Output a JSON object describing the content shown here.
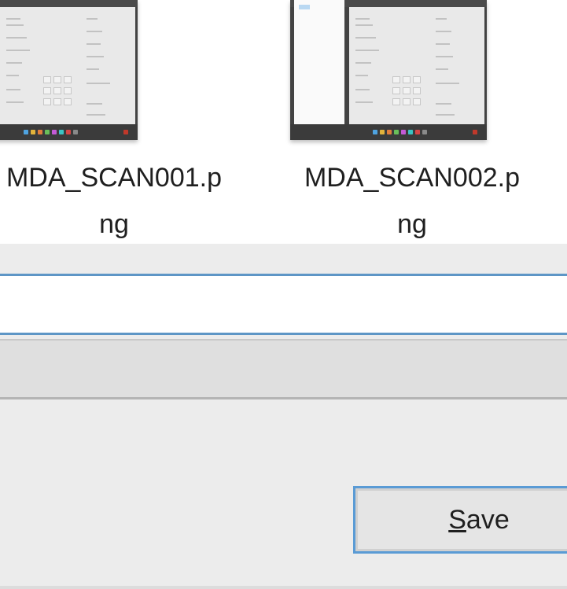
{
  "files": [
    {
      "name_line1": "MDA_SCAN001.p",
      "name_line2": "ng",
      "thumbnail_icon": "screenshot-thumbnail-icon"
    },
    {
      "name_line1": "MDA_SCAN002.p",
      "name_line2": "ng",
      "thumbnail_icon": "screenshot-thumbnail-icon"
    }
  ],
  "filename_field": {
    "value": ""
  },
  "save_type": {
    "value": ""
  },
  "save_button": {
    "access_key": "S",
    "label_rest": "ave"
  },
  "colors": {
    "focus_blue": "#5e96c6",
    "button_border": "#5a9bd5",
    "dialog_bg": "#ececec"
  }
}
